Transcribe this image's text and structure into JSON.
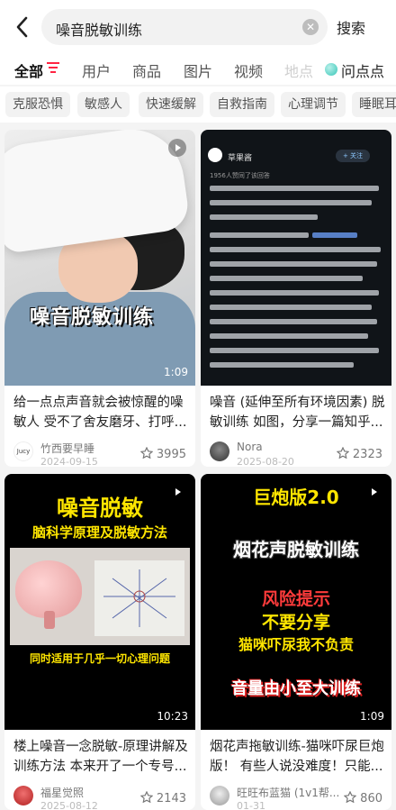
{
  "header": {
    "query": "噪音脱敏训练",
    "search_label": "搜索",
    "back_icon": "chevron-left-icon",
    "clear_icon": "clear-circle-icon"
  },
  "tabs": [
    {
      "label": "全部",
      "active": true
    },
    {
      "label": "用户"
    },
    {
      "label": "商品"
    },
    {
      "label": "图片"
    },
    {
      "label": "视频"
    },
    {
      "label": "地点"
    }
  ],
  "ask_label": "问点点",
  "chips": [
    "克服恐惧",
    "敏感人",
    "快速缓解",
    "自救指南",
    "心理调节",
    "睡眠耳"
  ],
  "cards": [
    {
      "cover_text": "噪音脱敏训练",
      "duration": "1:09",
      "title": "给一点点声音就会被惊醒的噪敏人 受不了舍友磨牙、打呼...",
      "author_avatar_text": "Jucy",
      "author": "竹西要早睡",
      "date": "2024-09-15",
      "likes": "3995"
    },
    {
      "cover_text": "草果酱",
      "cover_sub": "1956人赞同了该回答",
      "cover_follow": "+ 关注",
      "title": "噪音 (延伸至所有环境因素) 脱敏训练 如图，分享一篇知乎...",
      "author": "Nora",
      "date": "2025-08-20",
      "likes": "2323"
    },
    {
      "cover_title": "噪音脱敏",
      "cover_subtitle": "脑科学原理及脱敏方法",
      "cover_caption": "同时适用于几乎一切心理问题",
      "duration": "10:23",
      "title": "楼上噪音一念脱敏-原理讲解及训练方法 本来开了一个专号...",
      "author": "福星觉照",
      "date": "2025-08-12",
      "likes": "2143"
    },
    {
      "cover_lines": [
        "巨炮版2.0",
        "烟花声脱敏训练",
        "风险提示",
        "不要分享",
        "猫咪吓尿我不负责",
        "音量由小至大训练"
      ],
      "duration": "1:09",
      "title": "烟花声拖敏训练-猫咪吓尿巨炮版！ 有些人说没难度！只能...",
      "author": "旺旺布蓝猫 (1v1帮...",
      "date": "01-31",
      "likes": "860"
    }
  ],
  "colors": {
    "accent_red": "#ff2442",
    "ask_teal": "#39c7b8",
    "cover_yellow": "#ffe600"
  }
}
